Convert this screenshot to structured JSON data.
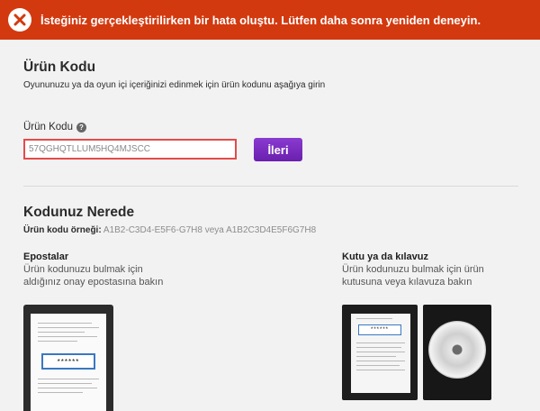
{
  "error": {
    "icon": "close-icon",
    "message": "İsteğiniz gerçekleştirilirken bir hata oluştu. Lütfen daha sonra yeniden deneyin."
  },
  "product_code": {
    "title": "Ürün Kodu",
    "description": "Oyununuzu ya da oyun içi içeriğinizi edinmek için ürün kodunu aşağıya girin",
    "label": "Ürün Kodu",
    "help_glyph": "?",
    "input_value": "57QGHQTLLUM5HQ4MJSCC",
    "next_label": "İleri"
  },
  "where": {
    "title": "Kodunuz Nerede",
    "example_label": "Ürün kodu örneği:",
    "example_value": "A1B2-C3D4-E5F6-G7H8 veya A1B2C3D4E5F6G7H8",
    "emails": {
      "title": "Epostalar",
      "desc_line1": "Ürün kodunuzu bulmak için",
      "desc_line2": "aldığınız onay epostasına bakın",
      "code_mask": "******"
    },
    "box": {
      "title": "Kutu ya da kılavuz",
      "desc_line1": "Ürün kodunuzu bulmak için ürün",
      "desc_line2": "kutusuna veya kılavuza bakın",
      "code_mask": "******"
    }
  },
  "colors": {
    "error_bar": "#d3390f",
    "accent_button": "#7a2cc3",
    "input_error_border": "#e64a4a"
  }
}
